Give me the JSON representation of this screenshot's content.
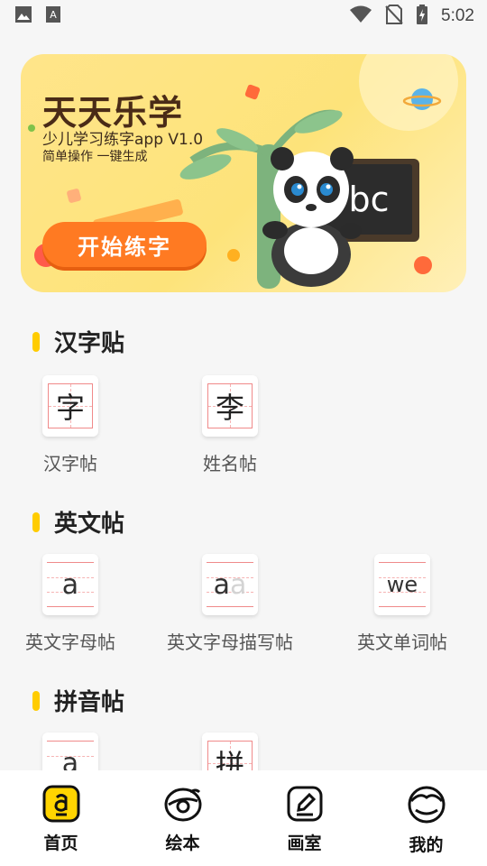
{
  "status_bar": {
    "time": "5:02"
  },
  "banner": {
    "title": "天天乐学",
    "subtitle": "少儿学习练字app V1.0",
    "tagline": "简单操作  一键生成",
    "button_label": "开始练字",
    "board_text": "bc"
  },
  "sections": [
    {
      "title": "汉字贴",
      "items": [
        {
          "glyph": "字",
          "label": "汉字帖"
        },
        {
          "glyph": "李",
          "label": "姓名帖"
        }
      ]
    },
    {
      "title": "英文帖",
      "items": [
        {
          "glyph": "a",
          "label": "英文字母帖"
        },
        {
          "glyph": "a",
          "ghost": "a",
          "label": "英文字母描写帖"
        },
        {
          "glyph": "we",
          "label": "英文单词帖"
        }
      ]
    },
    {
      "title": "拼音帖",
      "items": [
        {
          "glyph": "a"
        },
        {
          "glyph": "拼"
        }
      ]
    }
  ],
  "bottom_nav": [
    {
      "label": "首页",
      "icon": "home-icon"
    },
    {
      "label": "绘本",
      "icon": "picture-book-icon"
    },
    {
      "label": "画室",
      "icon": "studio-icon"
    },
    {
      "label": "我的",
      "icon": "profile-icon"
    }
  ],
  "colors": {
    "accent": "#ffcc00",
    "button": "#ff7a22",
    "banner": "#fde37a"
  }
}
